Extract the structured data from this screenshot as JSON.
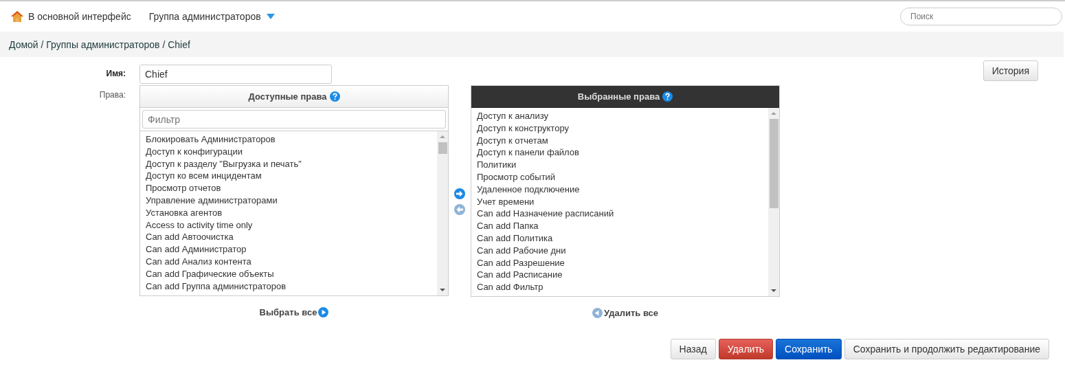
{
  "topbar": {
    "home_link": "В основной интерфейс",
    "menu": "Группа администраторов",
    "search": {
      "placeholder": "Поиск"
    }
  },
  "breadcrumb": "Домой / Группы администраторов / Chief",
  "history_button": "История",
  "form": {
    "name_label": "Имя:",
    "name_value": "Chief",
    "rights_label": "Права:"
  },
  "available": {
    "title": "Доступные права",
    "filter": {
      "placeholder": "Фильтр"
    },
    "items": [
      "Блокировать Администраторов",
      "Доступ к конфигурации",
      "Доступ к разделу \"Выгрузка и печать\"",
      "Доступ ко всем инцидентам",
      "Просмотр отчетов",
      "Управление администраторами",
      "Установка агентов",
      "Access to activity time only",
      "Can add Автоочистка",
      "Can add Администратор",
      "Can add Анализ контента",
      "Can add Графические объекты",
      "Can add Группа администраторов"
    ],
    "action": "Выбрать все"
  },
  "selected": {
    "title": "Выбранные права",
    "items": [
      "Доступ к анализу",
      "Доступ к конструктору",
      "Доступ к отчетам",
      "Доступ к панели файлов",
      "Политики",
      "Просмотр событий",
      "Удаленное подключение",
      "Учет времени",
      "Can add Назначение расписаний",
      "Can add Папка",
      "Can add Политика",
      "Can add Рабочие дни",
      "Can add Разрешение",
      "Can add Расписание",
      "Can add Фильтр"
    ],
    "action": "Удалить все"
  },
  "buttons": [
    {
      "label": "Назад",
      "kind": "default"
    },
    {
      "label": "Удалить",
      "kind": "danger"
    },
    {
      "label": "Сохранить",
      "kind": "primary"
    },
    {
      "label": "Сохранить и продолжить редактирование",
      "kind": "default"
    }
  ]
}
